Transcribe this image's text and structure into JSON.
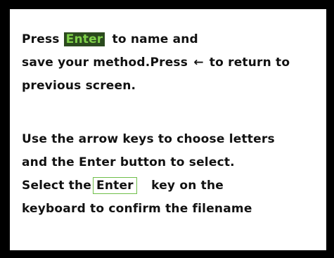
{
  "instructions": {
    "paragraph1": {
      "line1_before": "Press",
      "enter_key_highlight": "Enter",
      "line1_after": "to name and",
      "line2_before": "save your method.Press",
      "back_arrow": "←",
      "line2_after": "to return to",
      "line3": "previous screen."
    },
    "paragraph2": {
      "line1": "Use the arrow keys to choose letters",
      "line2": "and the Enter button to select.",
      "line3_before": "Select the",
      "enter_key_box": "Enter",
      "line3_after": "key on the",
      "line4": "keyboard to confirm the filename"
    }
  },
  "colors": {
    "highlight_bg": "#2b4a1e",
    "highlight_text": "#7fd14a",
    "box_border": "#6fbf4a"
  },
  "icons": {
    "back_arrow": "left-arrow-icon"
  }
}
